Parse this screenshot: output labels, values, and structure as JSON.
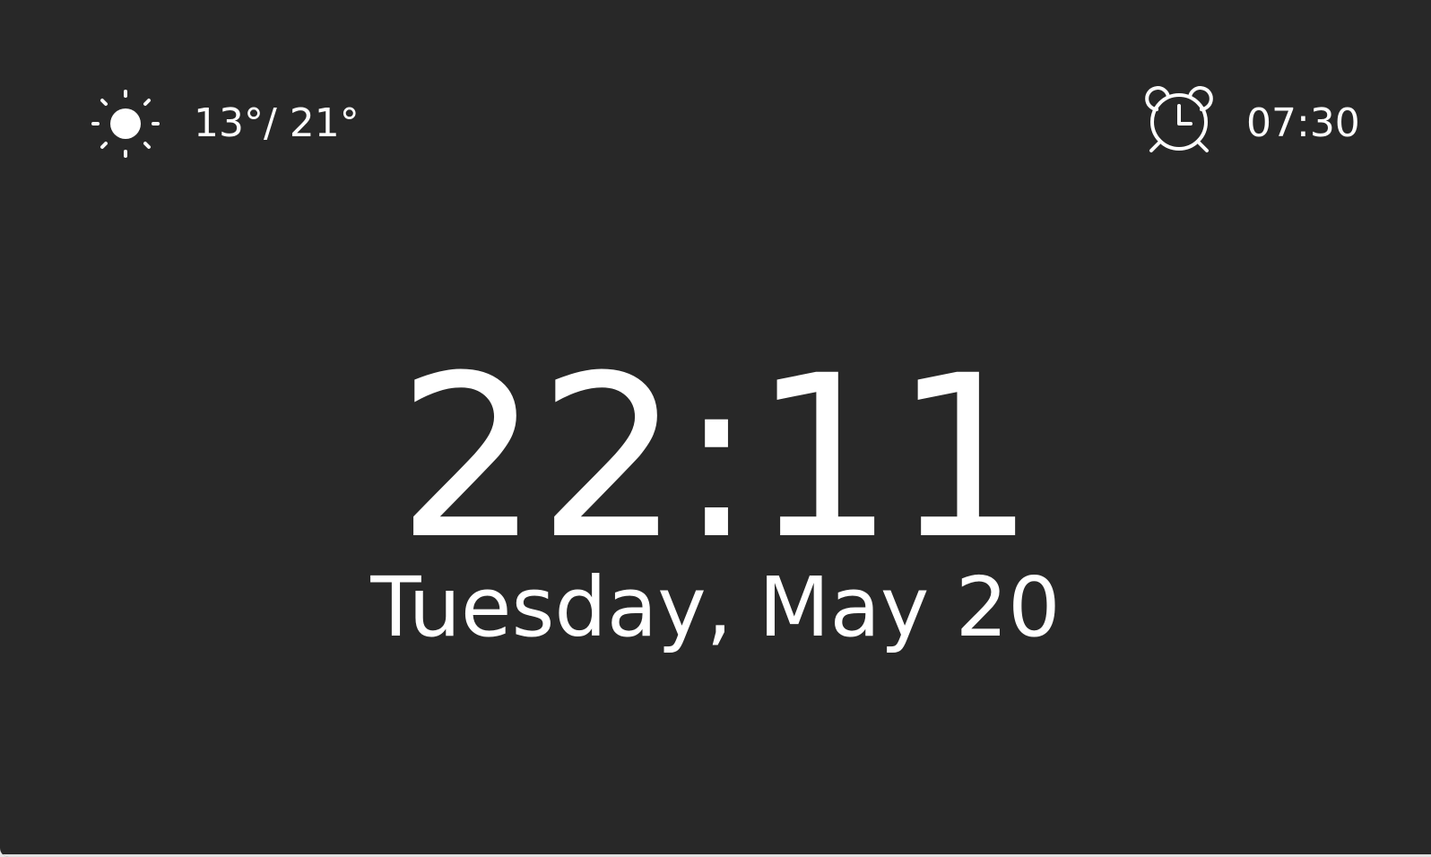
{
  "weather": {
    "icon": "sun-icon",
    "temperature_range": "13°/ 21°"
  },
  "alarm": {
    "icon": "alarm-clock-icon",
    "time": "07:30"
  },
  "clock": {
    "time": "22:11",
    "date": "Tuesday, May 20"
  },
  "colors": {
    "background": "#282828",
    "foreground": "#ffffff"
  }
}
